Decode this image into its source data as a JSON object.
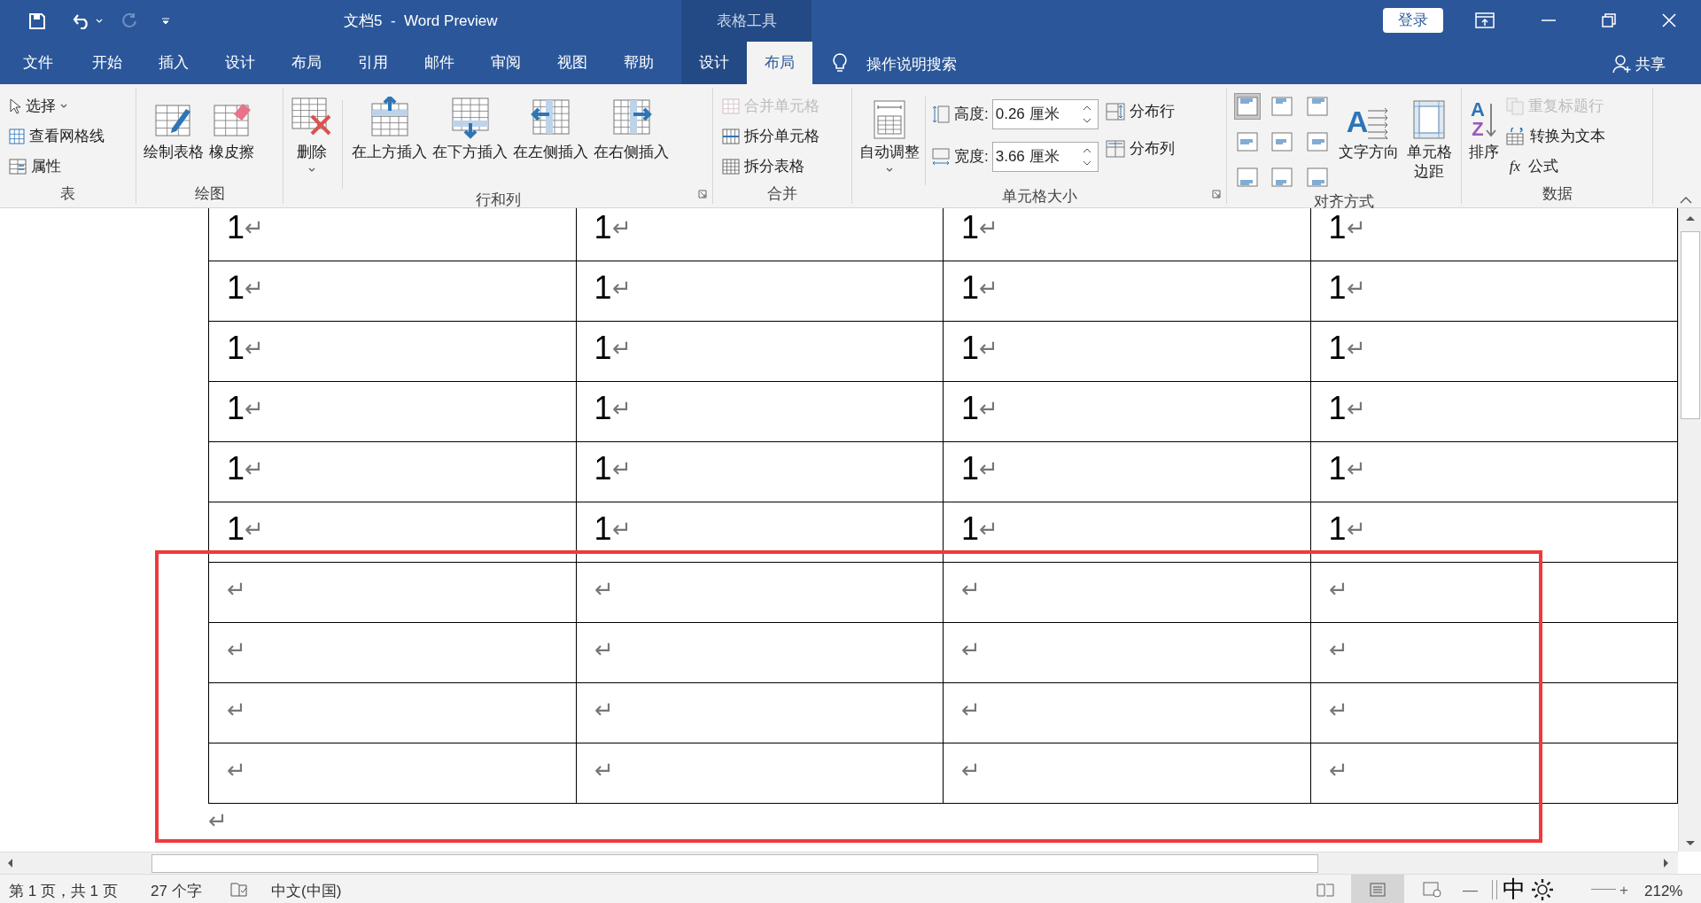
{
  "title_bar": {
    "title": "文档5  -  Word Preview",
    "context_label": "表格工具",
    "login": "登录"
  },
  "tabs": [
    {
      "label": "文件",
      "selected": false,
      "contextual": false
    },
    {
      "label": "开始",
      "selected": false,
      "contextual": false
    },
    {
      "label": "插入",
      "selected": false,
      "contextual": false
    },
    {
      "label": "设计",
      "selected": false,
      "contextual": false
    },
    {
      "label": "布局",
      "selected": false,
      "contextual": false
    },
    {
      "label": "引用",
      "selected": false,
      "contextual": false
    },
    {
      "label": "邮件",
      "selected": false,
      "contextual": false
    },
    {
      "label": "审阅",
      "selected": false,
      "contextual": false
    },
    {
      "label": "视图",
      "selected": false,
      "contextual": false
    },
    {
      "label": "帮助",
      "selected": false,
      "contextual": false
    },
    {
      "label": "设计",
      "selected": false,
      "contextual": true
    },
    {
      "label": "布局",
      "selected": true,
      "contextual": true
    }
  ],
  "tell_me": "操作说明搜索",
  "share": "共享",
  "ribbon": {
    "groups": [
      {
        "label": "表",
        "items": [
          {
            "kind": "small",
            "label": "选择",
            "caret": true
          },
          {
            "kind": "small",
            "label": "查看网格线"
          },
          {
            "kind": "small",
            "label": "属性"
          }
        ]
      },
      {
        "label": "绘图",
        "items": [
          {
            "kind": "large",
            "label": "绘制表格"
          },
          {
            "kind": "large",
            "label": "橡皮擦"
          }
        ]
      },
      {
        "label": "行和列",
        "launcher": true,
        "items": [
          {
            "kind": "large",
            "label": "删除",
            "caret": true
          },
          {
            "kind": "large",
            "label": "在上方插入"
          },
          {
            "kind": "large",
            "label": "在下方插入"
          },
          {
            "kind": "large",
            "label": "在左侧插入"
          },
          {
            "kind": "large",
            "label": "在右侧插入"
          }
        ]
      },
      {
        "label": "合并",
        "items": [
          {
            "kind": "small",
            "label": "合并单元格",
            "disabled": true
          },
          {
            "kind": "small",
            "label": "拆分单元格"
          },
          {
            "kind": "small",
            "label": "拆分表格"
          }
        ]
      },
      {
        "label": "单元格大小",
        "launcher": true,
        "items": [
          {
            "kind": "large",
            "label": "自动调整",
            "caret": true
          },
          {
            "kind": "field",
            "label": "高度:",
            "value": "0.26 厘米"
          },
          {
            "kind": "field",
            "label": "宽度:",
            "value": "3.66 厘米"
          },
          {
            "kind": "small",
            "label": "分布行"
          },
          {
            "kind": "small",
            "label": "分布列"
          }
        ]
      },
      {
        "label": "对齐方式",
        "items": [
          {
            "kind": "align_grid",
            "cells": [
              {
                "selected": true
              },
              {
                "selected": false
              },
              {
                "selected": false
              },
              {
                "selected": false
              },
              {
                "selected": false
              },
              {
                "selected": false
              },
              {
                "selected": false
              },
              {
                "selected": false
              },
              {
                "selected": false
              }
            ]
          },
          {
            "kind": "large",
            "label": "文字方向",
            "glyphs": [
              "A"
            ]
          },
          {
            "kind": "large",
            "label": "单元格边距"
          }
        ]
      },
      {
        "label": "数据",
        "items": [
          {
            "kind": "large",
            "label": "排序",
            "glyphs": [
              "A",
              "Z"
            ]
          },
          {
            "kind": "small",
            "label": "重复标题行",
            "disabled": true
          },
          {
            "kind": "small",
            "label": "转换为文本"
          },
          {
            "kind": "small",
            "label": "公式",
            "glyphs": [
              "fx"
            ]
          }
        ]
      }
    ]
  },
  "table": {
    "rows": [
      [
        {
          "text": "1",
          "mark": "↵"
        },
        {
          "text": "1",
          "mark": "↵"
        },
        {
          "text": "1",
          "mark": "↵"
        },
        {
          "text": "1",
          "mark": "↵"
        }
      ],
      [
        {
          "text": "1",
          "mark": "↵"
        },
        {
          "text": "1",
          "mark": "↵"
        },
        {
          "text": "1",
          "mark": "↵"
        },
        {
          "text": "1",
          "mark": "↵"
        }
      ],
      [
        {
          "text": "1",
          "mark": "↵"
        },
        {
          "text": "1",
          "mark": "↵"
        },
        {
          "text": "1",
          "mark": "↵"
        },
        {
          "text": "1",
          "mark": "↵"
        }
      ],
      [
        {
          "text": "1",
          "mark": "↵"
        },
        {
          "text": "1",
          "mark": "↵"
        },
        {
          "text": "1",
          "mark": "↵"
        },
        {
          "text": "1",
          "mark": "↵"
        }
      ],
      [
        {
          "text": "1",
          "mark": "↵"
        },
        {
          "text": "1",
          "mark": "↵"
        },
        {
          "text": "1",
          "mark": "↵"
        },
        {
          "text": "1",
          "mark": "↵"
        }
      ],
      [
        {
          "text": "1",
          "mark": "↵"
        },
        {
          "text": "1",
          "mark": "↵"
        },
        {
          "text": "1",
          "mark": "↵"
        },
        {
          "text": "1",
          "mark": "↵"
        }
      ],
      [
        {
          "mark": "↵"
        },
        {
          "mark": "↵"
        },
        {
          "mark": "↵"
        },
        {
          "mark": "↵"
        }
      ],
      [
        {
          "mark": "↵"
        },
        {
          "mark": "↵"
        },
        {
          "mark": "↵"
        },
        {
          "mark": "↵"
        }
      ],
      [
        {
          "mark": "↵"
        },
        {
          "mark": "↵"
        },
        {
          "mark": "↵"
        },
        {
          "mark": "↵"
        }
      ],
      [
        {
          "mark": "↵"
        },
        {
          "mark": "↵"
        },
        {
          "mark": "↵"
        },
        {
          "mark": "↵"
        }
      ]
    ]
  },
  "after_table_mark": "↵",
  "status_bar": {
    "page": "第 1 页，共 1 页",
    "words": "27 个字",
    "language": "中文(中国)",
    "ime": "中",
    "zoom_minus": "—",
    "zoom_plus": "+",
    "zoom": "212%"
  }
}
